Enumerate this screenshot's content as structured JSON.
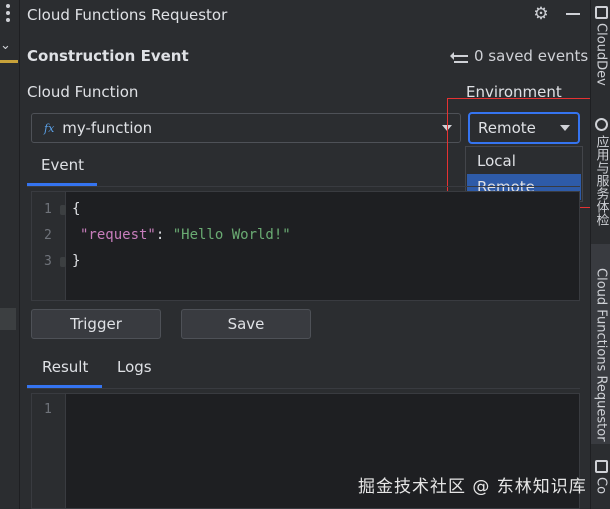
{
  "panel": {
    "title": "Cloud Functions Requestor",
    "section_title": "Construction Event",
    "saved_events": "0 saved events"
  },
  "form": {
    "cloud_function_label": "Cloud Function",
    "function_icon": "fx",
    "function_value": "my-function",
    "environment_label": "Environment",
    "environment_value": "Remote",
    "environment_options": [
      "Local",
      "Remote"
    ]
  },
  "tabs_top": {
    "event": "Event"
  },
  "editor": {
    "line_numbers": [
      "1",
      "2",
      "3"
    ],
    "open_brace": "{",
    "key": "\"request\"",
    "colon": ": ",
    "value": "\"Hello World!\"",
    "close_brace": "}"
  },
  "buttons": {
    "trigger": "Trigger",
    "save": "Save"
  },
  "tabs_bottom": {
    "result": "Result",
    "logs": "Logs"
  },
  "result": {
    "line_numbers": [
      "1"
    ]
  },
  "sidebar_right": {
    "clouddev": "CloudDev",
    "service": "应用与服务体检",
    "requestor": "Cloud Functions Requestor",
    "co": "Co"
  },
  "watermark": "掘金技术社区 @ 东林知识库",
  "colors": {
    "accent": "#3574f0",
    "selection": "#2e5ba8",
    "highlight_border": "#e53232",
    "json_key": "#c77dbb",
    "json_string": "#6aab73"
  }
}
